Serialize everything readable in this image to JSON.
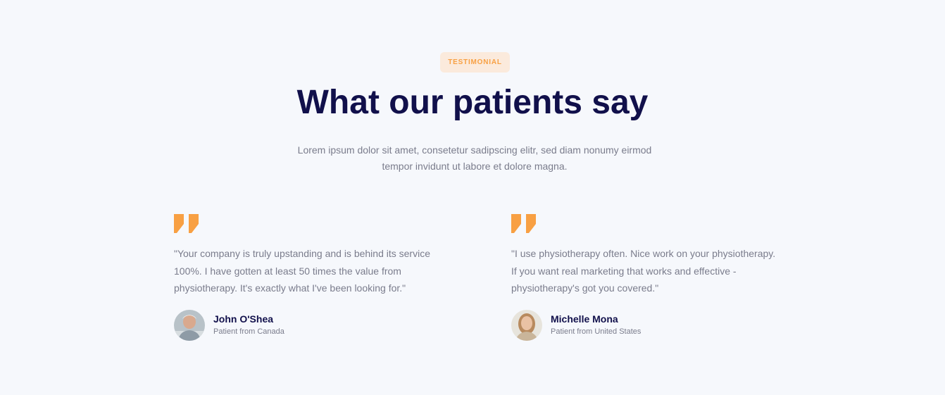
{
  "badge": "TESTIMONIAL",
  "title": "What our patients say",
  "subtitle": "Lorem ipsum dolor sit amet, consetetur sadipscing elitr, sed diam nonumy eirmod tempor invidunt ut labore et dolore magna.",
  "colors": {
    "background": "#f6f8fc",
    "accent": "#f8a043",
    "badge_bg": "#fbeadc",
    "heading": "#11104b",
    "body_text": "#7a7c8c"
  },
  "testimonials": [
    {
      "quote": "\"Your company is truly upstanding and is behind its service 100%. I have gotten at least 50 times the value from physiotherapy. It's exactly what I've been looking for.\"",
      "name": "John O'Shea",
      "role": "Patient from Canada",
      "icon": "quote-icon",
      "avatar_icon": "avatar-photo"
    },
    {
      "quote": "\"I use physiotherapy often. Nice work on your physiotherapy. If you want real marketing that works and effective - physiotherapy's got you covered.\"",
      "name": "Michelle Mona",
      "role": "Patient from United States",
      "icon": "quote-icon",
      "avatar_icon": "avatar-photo"
    }
  ]
}
